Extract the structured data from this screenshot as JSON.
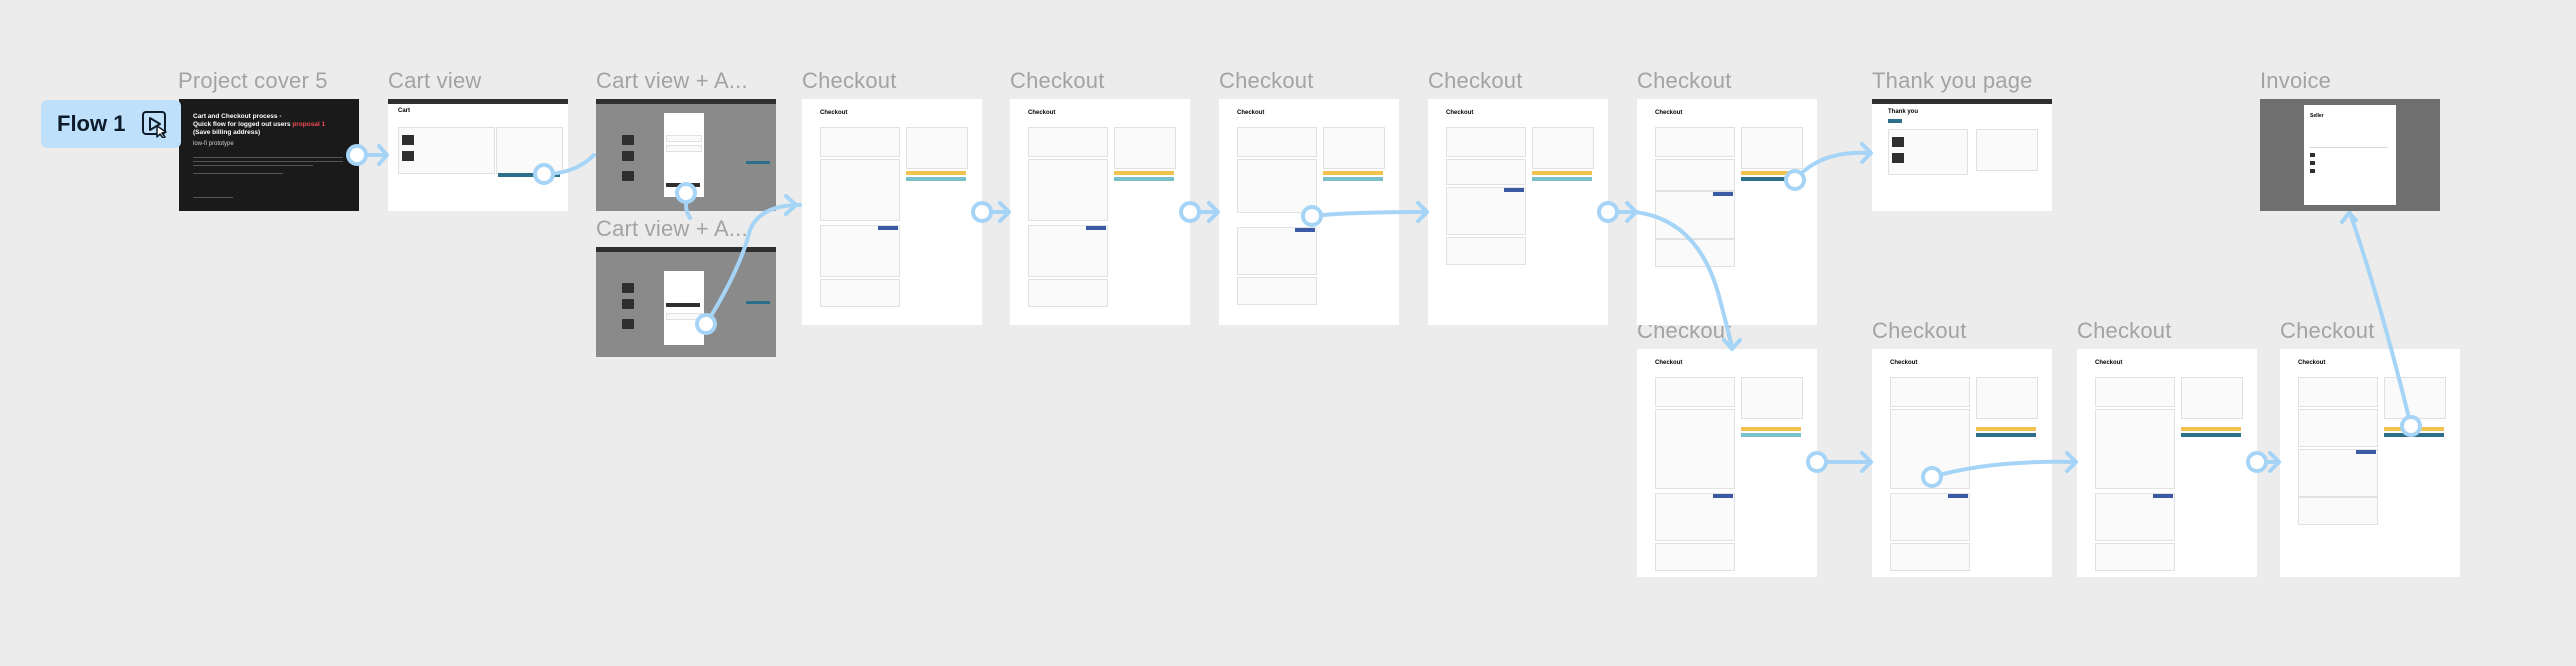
{
  "flow": {
    "label": "Flow 1"
  },
  "frames": [
    {
      "id": "project-cover",
      "title": "Project cover 5",
      "cover_title_a": "Cart and Checkout process -",
      "cover_title_b": "Quick flow for logged out users",
      "cover_title_highlight": "proposal 1",
      "cover_title_c": "(Save billing address)",
      "cover_subtitle": "low-fi prototype"
    },
    {
      "id": "cart-view",
      "title": "Cart view",
      "heading": "Cart"
    },
    {
      "id": "cart-view-a1",
      "title": "Cart view + A..."
    },
    {
      "id": "cart-view-a2",
      "title": "Cart view + A..."
    },
    {
      "id": "checkout-1",
      "title": "Checkout",
      "heading": "Checkout"
    },
    {
      "id": "checkout-2",
      "title": "Checkout",
      "heading": "Checkout"
    },
    {
      "id": "checkout-3",
      "title": "Checkout",
      "heading": "Checkout"
    },
    {
      "id": "checkout-4",
      "title": "Checkout",
      "heading": "Checkout"
    },
    {
      "id": "checkout-5",
      "title": "Checkout",
      "heading": "Checkout"
    },
    {
      "id": "thank-you",
      "title": "Thank you page",
      "heading": "Thank you"
    },
    {
      "id": "invoice",
      "title": "Invoice",
      "heading": "Seller"
    },
    {
      "id": "checkout-6",
      "title": "Checkout",
      "heading": "Checkout"
    },
    {
      "id": "checkout-7",
      "title": "Checkout",
      "heading": "Checkout"
    },
    {
      "id": "checkout-8",
      "title": "Checkout",
      "heading": "Checkout"
    },
    {
      "id": "checkout-9",
      "title": "Checkout",
      "heading": "Checkout"
    }
  ],
  "colors": {
    "canvas": "#ececec",
    "connector": "#a6d4f7",
    "flow_badge": "#bfe0fb",
    "cover_bg": "#1a1a1a",
    "title_gray": "#a3a3a3"
  },
  "icons": {
    "flow_play": "play-cursor-icon"
  }
}
